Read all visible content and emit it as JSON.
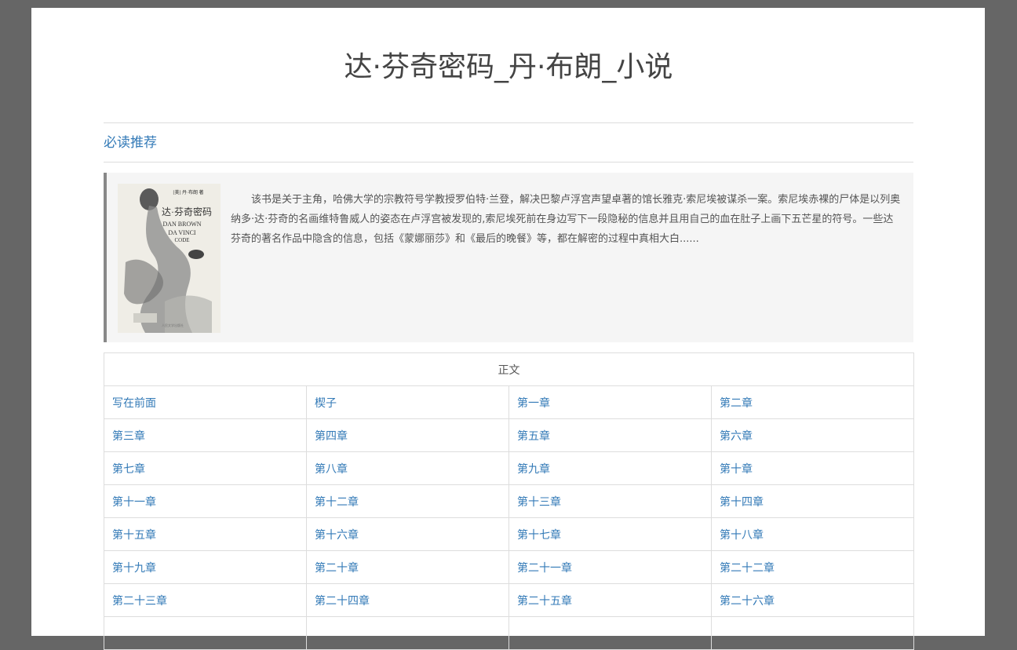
{
  "page": {
    "title": "达·芬奇密码_丹·布朗_小说",
    "section_heading": "必读推荐"
  },
  "intro": {
    "text": "该书是关于主角，哈佛大学的宗教符号学教授罗伯特·兰登，解决巴黎卢浮宫声望卓著的馆长雅克·索尼埃被谋杀一案。索尼埃赤裸的尸体是以列奥纳多·达·芬奇的名画维特鲁威人的姿态在卢浮宫被发现的,索尼埃死前在身边写下一段隐秘的信息并且用自己的血在肚子上画下五芒星的符号。一些达芬奇的著名作品中隐含的信息，包括《蒙娜丽莎》和《最后的晚餐》等，都在解密的过程中真相大白......",
    "cover": {
      "title_cn": "达·芬奇密码",
      "author_en": "DAN BROWN",
      "title_en_1": "DA VINCI",
      "title_en_2": "CODE",
      "credits": "[美] 丹·布朗 著",
      "publisher": "人民文学出版社"
    }
  },
  "toc": {
    "header": "正文",
    "chapters": [
      "写在前面",
      "楔子",
      "第一章",
      "第二章",
      "第三章",
      "第四章",
      "第五章",
      "第六章",
      "第七章",
      "第八章",
      "第九章",
      "第十章",
      "第十一章",
      "第十二章",
      "第十三章",
      "第十四章",
      "第十五章",
      "第十六章",
      "第十七章",
      "第十八章",
      "第十九章",
      "第二十章",
      "第二十一章",
      "第二十二章",
      "第二十三章",
      "第二十四章",
      "第二十五章",
      "第二十六章"
    ]
  },
  "colors": {
    "link": "#337ab7",
    "backdrop": "#666666",
    "accent_border": "#888888"
  }
}
